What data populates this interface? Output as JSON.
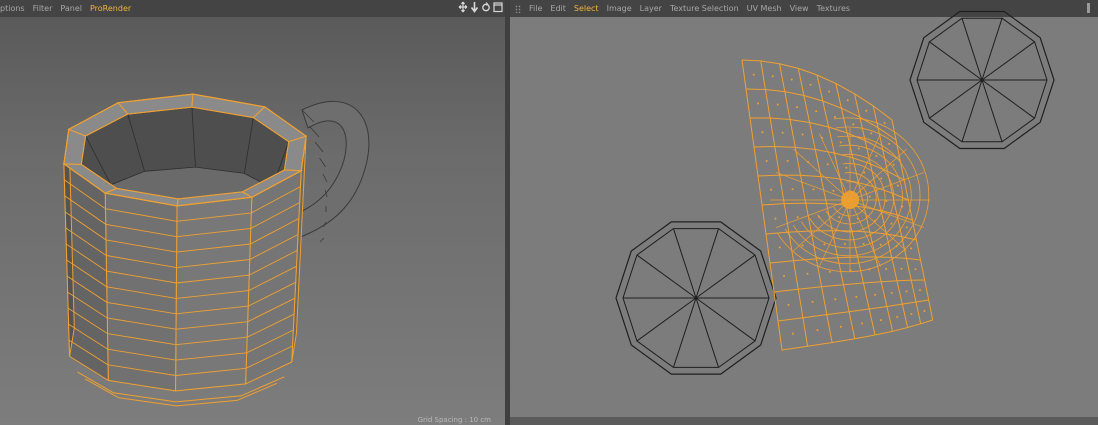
{
  "viewport_3d": {
    "menu": [
      {
        "label": "ptions",
        "active": false
      },
      {
        "label": "Filter",
        "active": false
      },
      {
        "label": "Panel",
        "active": false
      },
      {
        "label": "ProRender",
        "active": true
      }
    ],
    "nav_icons": [
      "move-icon",
      "zoom-icon",
      "rotate-icon",
      "maximize-icon"
    ],
    "grid_spacing": "Grid Spacing : 10 cm"
  },
  "uv_editor": {
    "menu": [
      {
        "label": "File",
        "active": false
      },
      {
        "label": "Edit",
        "active": false
      },
      {
        "label": "Select",
        "active": true
      },
      {
        "label": "Image",
        "active": false
      },
      {
        "label": "Layer",
        "active": false
      },
      {
        "label": "Texture Selection",
        "active": false
      },
      {
        "label": "UV Mesh",
        "active": false
      },
      {
        "label": "View",
        "active": false
      },
      {
        "label": "Textures",
        "active": false
      }
    ]
  },
  "colors": {
    "wire": "#f0a030",
    "uv_polygon": "#1f1f1f",
    "menu_active": "#f1b33c"
  }
}
